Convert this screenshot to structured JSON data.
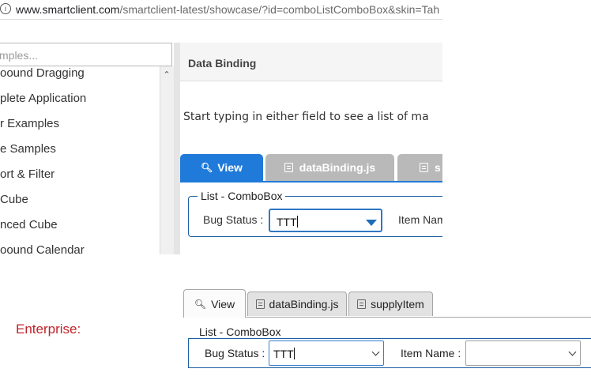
{
  "browser": {
    "url_domain": "www.smartclient.com",
    "url_rest": "/smartclient-latest/showcase/?id=comboListComboBox&skin=Tah"
  },
  "sidebar": {
    "search_placeholder": "mples...",
    "items": [
      "oound Dragging",
      "plete Application",
      "r Examples",
      "e Samples",
      "ort & Filter",
      " Cube",
      "nced Cube",
      "oound Calendar"
    ]
  },
  "main": {
    "title": "Data Binding",
    "description": "Start typing in either field to see a list of ma",
    "tabs": [
      {
        "label": "View",
        "icon": "search-icon"
      },
      {
        "label": "dataBinding.js",
        "icon": "document-icon"
      },
      {
        "label": "s",
        "icon": "document-icon"
      }
    ],
    "form": {
      "legend": "List - ComboBox",
      "bug_status_label": "Bug Status :",
      "bug_status_value": "TTT",
      "item_name_label": "Item Nam"
    }
  },
  "enterprise": {
    "label": "Enterprise:",
    "tabs": [
      {
        "label": "View",
        "icon": "search-icon"
      },
      {
        "label": "dataBinding.js",
        "icon": "document-icon"
      },
      {
        "label": "supplyItem",
        "icon": "document-icon"
      }
    ],
    "form": {
      "legend": "List - ComboBox",
      "bug_status_label": "Bug Status :",
      "bug_status_value": "TTT",
      "item_name_label": "Item Name :",
      "item_name_value": ""
    }
  },
  "colors": {
    "tab_active": "#1f7ad9",
    "tab_inactive": "#b9b9b9",
    "fieldset_border": "#1c5fa3",
    "enterprise_label": "#c0212a"
  }
}
